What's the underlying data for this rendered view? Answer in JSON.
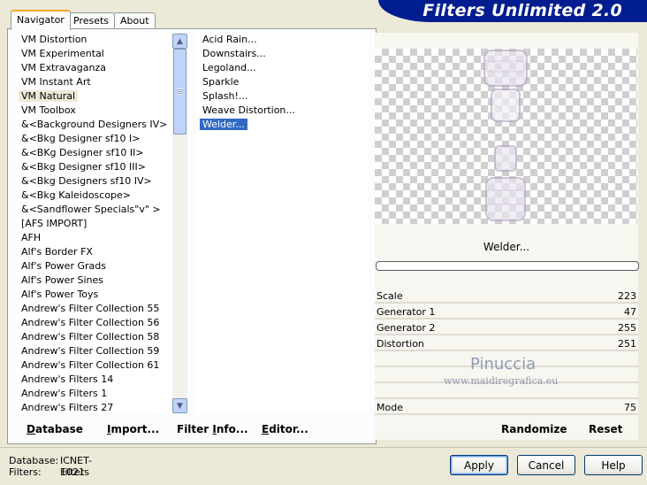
{
  "app_title": "Filters Unlimited 2.0",
  "tabs": [
    "Navigator",
    "Presets",
    "About"
  ],
  "categories": [
    "VM Distortion",
    "VM Experimental",
    "VM Extravaganza",
    "VM Instant Art",
    "VM Natural",
    "VM Toolbox",
    "&<Background Designers IV>",
    "&<Bkg Designer sf10 I>",
    "&<BKg Designer sf10 II>",
    "&<Bkg Designer sf10 III>",
    "&<Bkg Designers sf10 IV>",
    "&<Bkg Kaleidoscope>",
    "&<Sandflower Specials\"v\" >",
    "[AFS IMPORT]",
    "AFH",
    "Alf's Border FX",
    "Alf's Power Grads",
    "Alf's Power Sines",
    "Alf's Power Toys",
    "Andrew's Filter Collection 55",
    "Andrew's Filter Collection 56",
    "Andrew's Filter Collection 58",
    "Andrew's Filter Collection 59",
    "Andrew's Filter Collection 61",
    "Andrew's Filters 14",
    "Andrew's Filters 1",
    "Andrew's Filters 27"
  ],
  "selected_category": "VM Natural",
  "filters": [
    "Acid Rain...",
    "Downstairs...",
    "Legoland...",
    "Sparkle",
    "Splash!...",
    "Weave Distortion...",
    "Welder..."
  ],
  "selected_filter": "Welder...",
  "left_buttons": {
    "database": {
      "u": "D",
      "rest": "atabase"
    },
    "import": {
      "u": "I",
      "rest": "mport..."
    },
    "filter_info": {
      "u": "",
      "pre": "Filter ",
      "u2": "I",
      "rest": "nfo..."
    },
    "editor": {
      "u": "E",
      "rest": "ditor..."
    }
  },
  "filter_name": "Welder...",
  "progress": 0,
  "params": [
    {
      "label": "Scale",
      "value": "223"
    },
    {
      "label": "Generator 1",
      "value": "47"
    },
    {
      "label": "Generator 2",
      "value": "255"
    },
    {
      "label": "Distortion",
      "value": "251"
    },
    {
      "label": "Mode",
      "value": "75"
    }
  ],
  "watermark": {
    "line1": "Pinuccia",
    "line2": "www.maidiregrafica.eu"
  },
  "right_buttons": {
    "randomize": "Randomize",
    "reset": "Reset"
  },
  "footer": {
    "database_label": "Database:",
    "database_value": "ICNET-Filters",
    "filters_label": "Filters:",
    "filters_value": "1021"
  },
  "dialog_buttons": {
    "apply": "Apply",
    "cancel": "Cancel",
    "help": "Help"
  },
  "colors": {
    "banner": "#001d8f",
    "selection": "#316ac5"
  }
}
